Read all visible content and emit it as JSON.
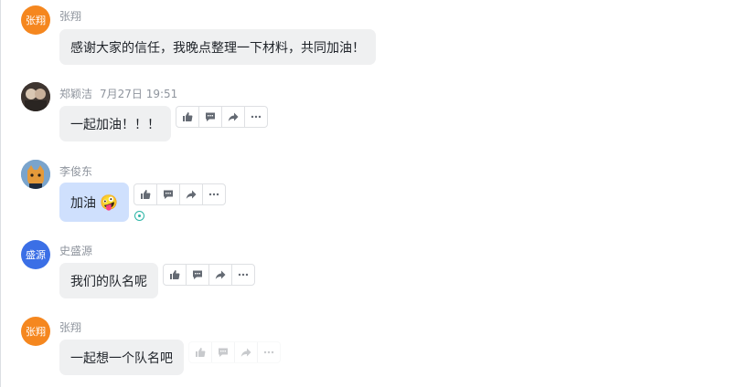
{
  "messages": [
    {
      "sender": "张翔",
      "time": "",
      "avatar_text": "张翔",
      "avatar_color": "#f5871f",
      "text": "感谢大家的信任，我晚点整理一下材料，共同加油！"
    },
    {
      "sender": "郑颖洁",
      "time": "7月27日 19:51",
      "avatar_text": "",
      "text": "一起加油！！！"
    },
    {
      "sender": "李俊东",
      "time": "",
      "avatar_text": "",
      "text": "加油",
      "emoji": "🤪"
    },
    {
      "sender": "史盛源",
      "time": "",
      "avatar_text": "盛源",
      "avatar_color": "#3b6fe6",
      "text": "我们的队名呢"
    },
    {
      "sender": "张翔",
      "time": "",
      "avatar_text": "张翔",
      "avatar_color": "#f5871f",
      "text": "一起想一个队名吧"
    }
  ],
  "toolbar_icons": [
    "thumbs-up-icon",
    "reply-icon",
    "forward-icon",
    "more-icon"
  ],
  "colors": {
    "bubble": "#eff0f1",
    "own_bubble": "#cfe0fd",
    "read_status": "#2bb5a6"
  }
}
